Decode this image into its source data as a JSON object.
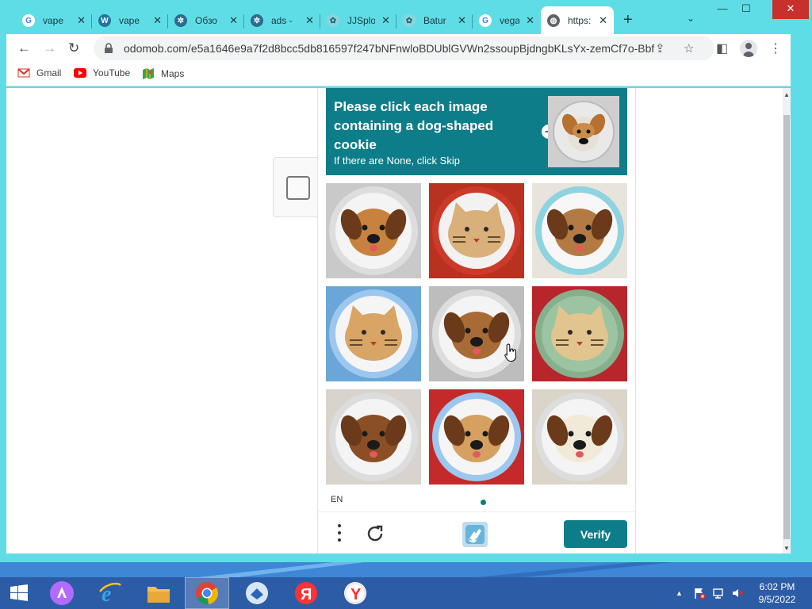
{
  "tabs": [
    {
      "label": "vape",
      "icon": "google-icon",
      "close": "✕"
    },
    {
      "label": "vape",
      "icon": "wordpress-icon",
      "close": "✕"
    },
    {
      "label": "Обзо",
      "icon": "globe-icon",
      "close": "✕"
    },
    {
      "label": "ads -",
      "icon": "globe-icon",
      "close": "✕"
    },
    {
      "label": "JJSplo",
      "icon": "web-icon",
      "close": "✕"
    },
    {
      "label": "Batur",
      "icon": "web-icon",
      "close": "✕"
    },
    {
      "label": "vegas",
      "icon": "google-icon",
      "close": "✕"
    },
    {
      "label": "https:",
      "icon": "globe-icon",
      "close": "✕"
    }
  ],
  "window": {
    "minimize": "—",
    "maximize": "☐",
    "close": "✕",
    "new_tab": "+",
    "tab_menu": "⌄"
  },
  "address": {
    "url": "odomob.com/e5a1646e9a7f2d8bcc5db816597f247bNFnwloBDUblGVWn2ssoupBjdngbKLsYx-zemCf7o-Bbf..."
  },
  "bookmarks": [
    {
      "label": "Gmail",
      "icon": "gmail-icon"
    },
    {
      "label": "YouTube",
      "icon": "youtube-icon"
    },
    {
      "label": "Maps",
      "icon": "maps-icon"
    }
  ],
  "captcha": {
    "title": "Please click each image containing a dog-shaped cookie",
    "subtitle": "If there are None, click Skip",
    "language": "EN",
    "verify_label": "Verify",
    "tiles": [
      {
        "subject": "dog",
        "plate": "white",
        "bg": "#c9c9c9",
        "cookie": "#c8823f"
      },
      {
        "subject": "cat",
        "plate": "red",
        "bg": "#b8321f",
        "cookie": "#d9b07a"
      },
      {
        "subject": "dog",
        "plate": "white-blue",
        "bg": "#e8e4dc",
        "cookie": "#b37a43"
      },
      {
        "subject": "cat",
        "plate": "blue",
        "bg": "#6aa7d8",
        "cookie": "#d8a565"
      },
      {
        "subject": "dog",
        "plate": "white",
        "bg": "#bdbdbd",
        "cookie": "#a96b36"
      },
      {
        "subject": "cat",
        "plate": "green",
        "bg": "#b8262b",
        "cookie": "#e2c48e"
      },
      {
        "subject": "dog",
        "plate": "white",
        "bg": "#d8d4cd",
        "cookie": "#8a4f25"
      },
      {
        "subject": "dog",
        "plate": "blue",
        "bg": "#c42a2a",
        "cookie": "#d5a060"
      },
      {
        "subject": "dog",
        "plate": "white",
        "bg": "#dad4c9",
        "cookie": "#f2ead8"
      }
    ]
  },
  "taskbar": {
    "items": [
      "windows-start-icon",
      "alice-icon",
      "ie-icon",
      "file-explorer-icon",
      "chrome-icon",
      "mail-icon",
      "yandex-icon",
      "yandex-browser-icon"
    ],
    "time": "6:02 PM",
    "date": "9/5/2022",
    "tray_arrow": "▲"
  }
}
